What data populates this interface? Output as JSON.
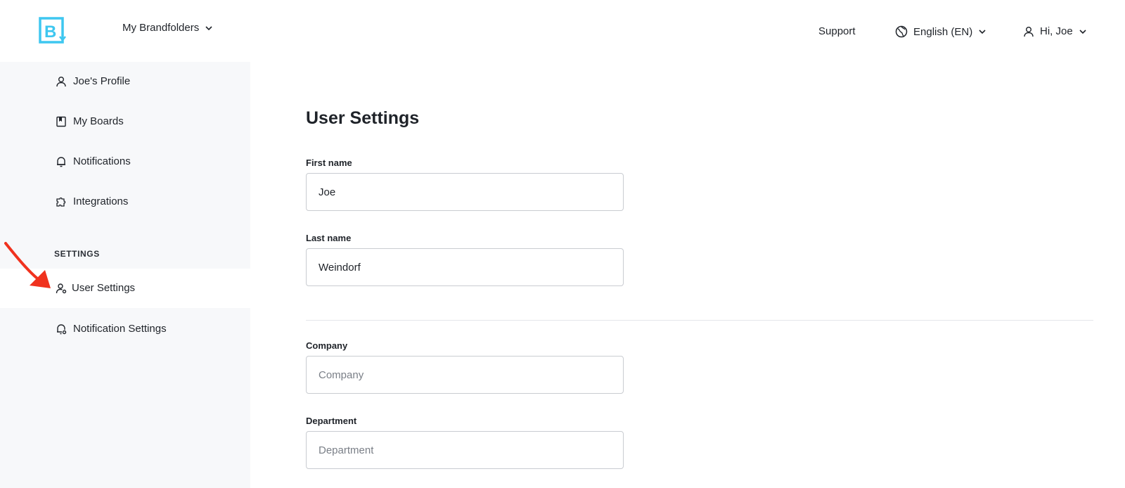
{
  "header": {
    "brand_menu": "My Brandfolders",
    "support": "Support",
    "language": "English (EN)",
    "greeting": "Hi, Joe"
  },
  "sidebar": {
    "items": [
      {
        "label": "Joe's Profile"
      },
      {
        "label": "My Boards"
      },
      {
        "label": "Notifications"
      },
      {
        "label": "Integrations"
      }
    ],
    "section_label": "SETTINGS",
    "settings_items": [
      {
        "label": "User Settings",
        "active": true
      },
      {
        "label": "Notification Settings"
      }
    ]
  },
  "main": {
    "title": "User Settings",
    "fields": {
      "first_name": {
        "label": "First name",
        "value": "Joe"
      },
      "last_name": {
        "label": "Last name",
        "value": "Weindorf"
      },
      "company": {
        "label": "Company",
        "value": "",
        "placeholder": "Company"
      },
      "department": {
        "label": "Department",
        "value": "",
        "placeholder": "Department"
      }
    }
  },
  "colors": {
    "brand_cyan": "#3ec7f0",
    "sidebar_bg": "#f7f8fa",
    "annotation_red": "#f0321e"
  },
  "icons": {
    "logo": "brandfolder-logo-icon",
    "profile": "user-icon",
    "boards": "bookmark-book-icon",
    "notifications": "bell-icon",
    "integrations": "puzzle-icon",
    "user_settings": "user-gear-icon",
    "notification_settings": "bell-gear-icon",
    "language": "globe-icon"
  }
}
